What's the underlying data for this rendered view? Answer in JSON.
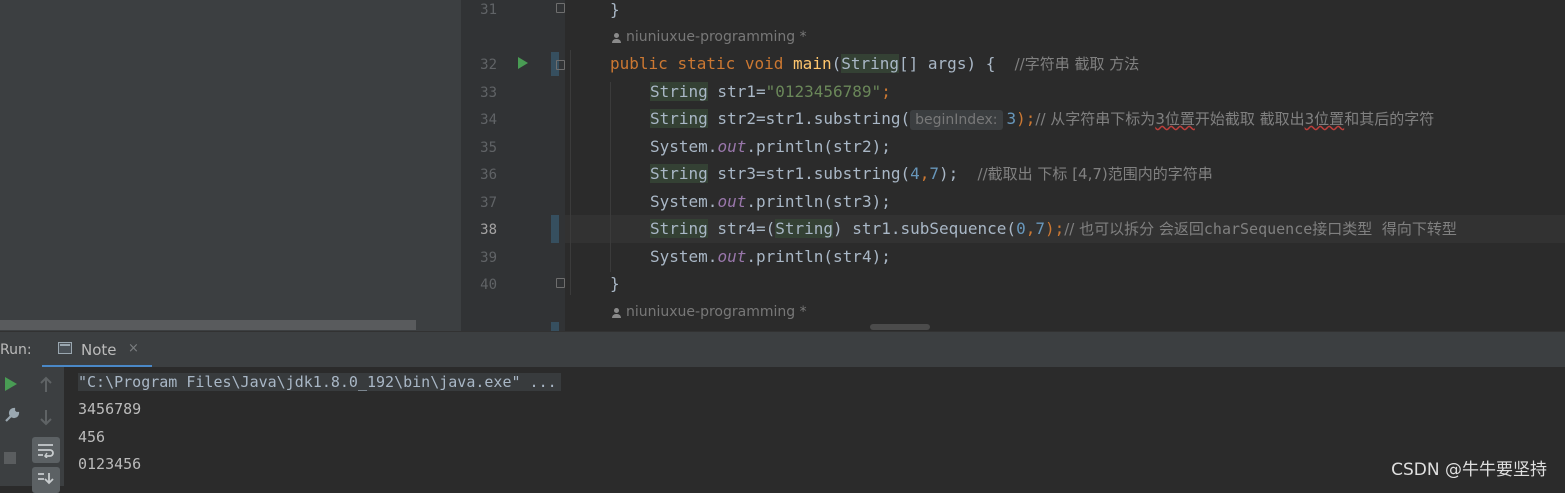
{
  "editor": {
    "line_numbers": [
      "31",
      "32",
      "33",
      "34",
      "35",
      "36",
      "37",
      "38",
      "39",
      "40"
    ],
    "current_line": "38",
    "author_annotation": "niuniuxue-programming *",
    "lines": {
      "l31": "}",
      "l32_kw1": "public",
      "l32_kw2": "static",
      "l32_kw3": "void",
      "l32_fn": "main",
      "l32_rest_a": "(",
      "l32_cls": "String",
      "l32_rest_b": "[] args) {  ",
      "l32_comment": "//字符串 截取 方法",
      "l33_cls": "String",
      "l33_a": " str1=",
      "l33_str": "\"0123456789\"",
      "l33_semi": ";",
      "l34_cls": "String",
      "l34_a": " str2=str1.substring(",
      "l34_hint": "beginIndex:",
      "l34_num": "3",
      "l34_b": ");",
      "l34_comment_a": "// 从字符串下标为",
      "l34_comment_b": "3位置",
      "l34_comment_c": "开始截取 截取出",
      "l34_comment_d": "3位置",
      "l34_comment_e": "和其后的字符",
      "l35_a": "System.",
      "l35_fld": "out",
      "l35_b": ".println(str2);",
      "l36_cls": "String",
      "l36_a": " str3=str1.substring(",
      "l36_n1": "4",
      "l36_comma": ",",
      "l36_n2": "7",
      "l36_b": ");  ",
      "l36_comment": "//截取出 下标 [4,7)范围内的字符串",
      "l37_a": "System.",
      "l37_fld": "out",
      "l37_b": ".println(str3);",
      "l38_cls": "String",
      "l38_a": " str4=(",
      "l38_cls2": "String",
      "l38_b": ") str1.subSequence(",
      "l38_n1": "0",
      "l38_comma": ",",
      "l38_n2": "7",
      "l38_c": ");",
      "l38_comment_a": "// 也可以拆分 会返回",
      "l38_comment_b": "charSequence",
      "l38_comment_c": "接口类型  得向下转型",
      "l39_a": "System.",
      "l39_fld": "out",
      "l39_b": ".println(str4);",
      "l40": "}"
    }
  },
  "run_panel": {
    "label": "Run:",
    "tab_label": "Note",
    "tab_close": "×",
    "output": [
      "\"C:\\Program Files\\Java\\jdk1.8.0_192\\bin\\java.exe\" ...",
      "3456789",
      "456",
      "0123456"
    ]
  },
  "toolbar_icons": [
    "run-icon",
    "up-arrow-icon",
    "wrench-icon",
    "down-arrow-icon",
    "stop-icon",
    "soft-wrap-icon",
    "scroll-to-end-icon"
  ],
  "watermark": "CSDN @牛牛要坚持",
  "colors": {
    "keyword": "#cc7832",
    "function": "#ffc66d",
    "string": "#6a8759",
    "number": "#6897bb",
    "comment": "#808080",
    "field": "#9876aa",
    "accent": "#4a88c7"
  }
}
